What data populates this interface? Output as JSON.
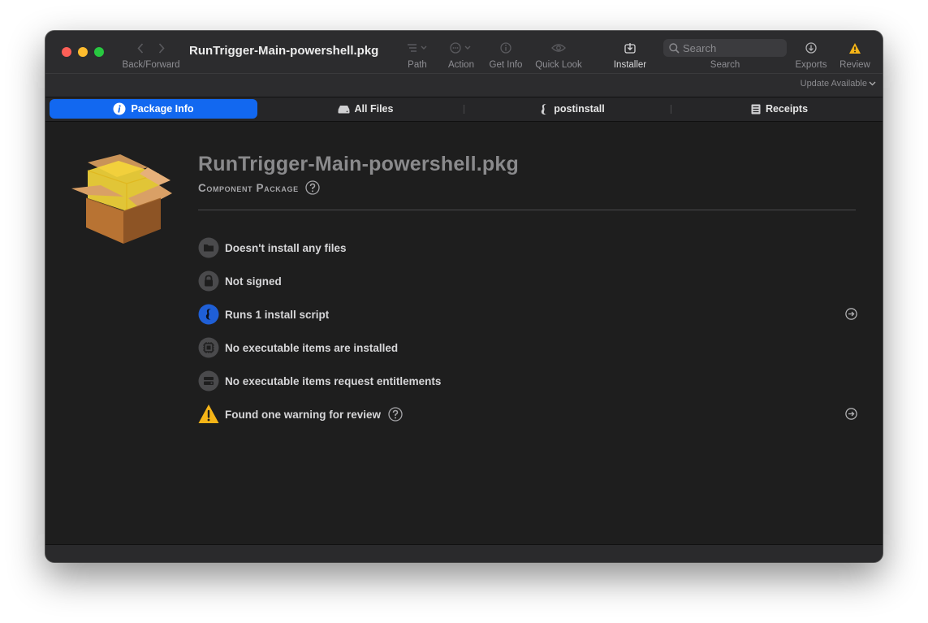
{
  "window": {
    "title": "RunTrigger-Main-powershell.pkg"
  },
  "toolbar": {
    "back_forward_label": "Back/Forward",
    "path_label": "Path",
    "action_label": "Action",
    "get_info_label": "Get Info",
    "quick_look_label": "Quick Look",
    "installer_label": "Installer",
    "search_label": "Search",
    "search_placeholder": "Search",
    "exports_label": "Exports",
    "review_label": "Review",
    "update_available": "Update Available"
  },
  "tabs": [
    {
      "label": "Package Info",
      "icon": "info-circle-icon"
    },
    {
      "label": "All Files",
      "icon": "drive-icon"
    },
    {
      "label": "postinstall",
      "icon": "script-icon"
    },
    {
      "label": "Receipts",
      "icon": "receipt-icon"
    }
  ],
  "package": {
    "name": "RunTrigger-Main-powershell.pkg",
    "type": "Component Package"
  },
  "summary": [
    {
      "text": "Doesn't install any files",
      "icon": "folder-icon"
    },
    {
      "text": "Not signed",
      "icon": "lock-icon"
    },
    {
      "text": "Runs 1 install script",
      "icon": "script-icon"
    },
    {
      "text": "No executable items are installed",
      "icon": "chip-icon"
    },
    {
      "text": "No executable items request entitlements",
      "icon": "entitlement-icon"
    },
    {
      "text": "Found one warning for review",
      "icon": "warning-icon"
    }
  ],
  "colors": {
    "accent": "#1268f0",
    "warning": "#f5b417",
    "window_bg": "#1e1e1e"
  }
}
